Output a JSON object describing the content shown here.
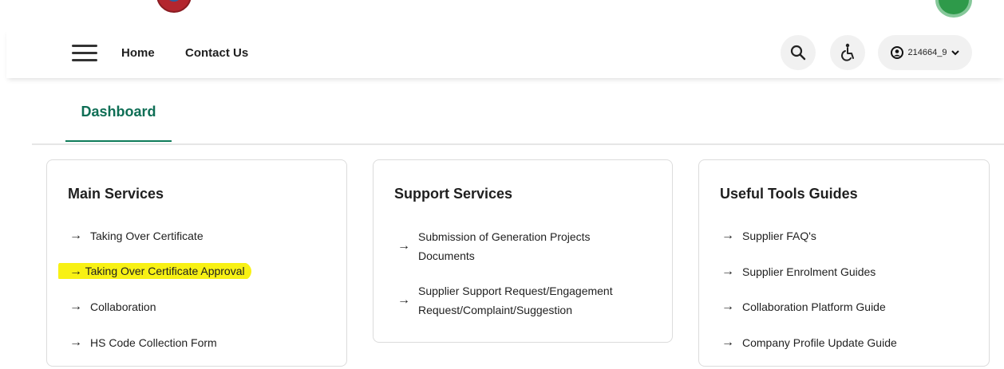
{
  "header": {
    "nav_home": "Home",
    "nav_contact": "Contact Us",
    "user_label": "214664_9"
  },
  "tabs": {
    "active": "Dashboard"
  },
  "main_services": {
    "title": "Main Services",
    "items": [
      "Taking Over Certificate",
      "Taking Over Certificate Approval",
      "Collaboration",
      "HS Code Collection Form"
    ]
  },
  "support_services": {
    "title": "Support Services",
    "items": [
      "Submission of Generation Projects Documents",
      "Supplier Support Request/Engagement Request/Complaint/Suggestion"
    ]
  },
  "useful_tools": {
    "title": "Useful Tools Guides",
    "items": [
      "Supplier FAQ's",
      "Supplier Enrolment Guides",
      "Collaboration Platform Guide",
      "Company Profile Update Guide"
    ]
  },
  "colors": {
    "accent": "#0e6e55",
    "highlight": "#f8f114"
  }
}
